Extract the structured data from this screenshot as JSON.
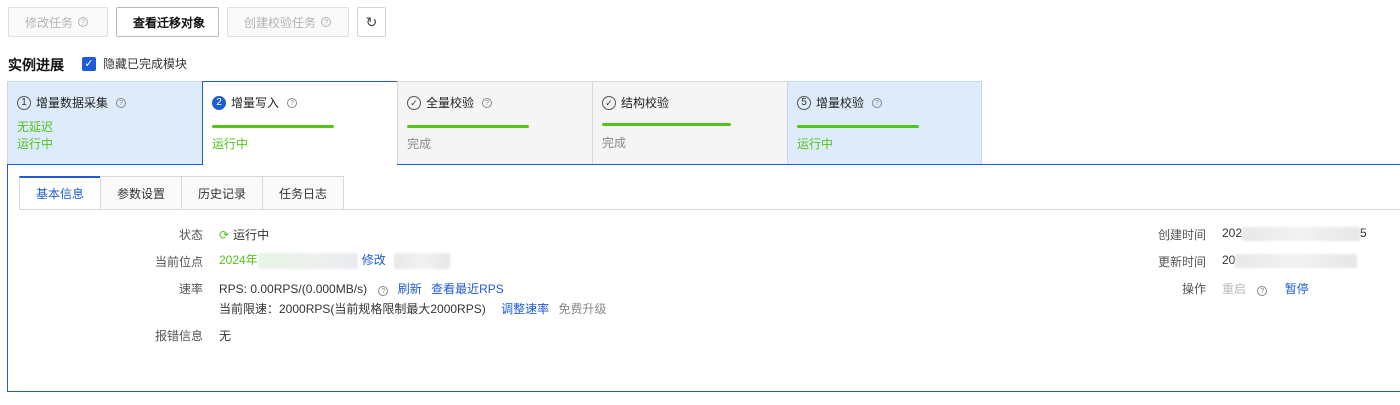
{
  "toolbar": {
    "modify_task": "修改任务",
    "view_migration": "查看迁移对象",
    "create_check_task": "创建校验任务",
    "refresh_icon": "refresh-icon"
  },
  "progress": {
    "title": "实例进展",
    "hide_completed": "隐藏已完成模块",
    "hide_completed_checked": true
  },
  "steps": [
    {
      "num": "1",
      "label": "增量数据采集",
      "line1": "无延迟",
      "line2": "运行中"
    },
    {
      "num": "2",
      "label": "增量写入",
      "status": "运行中"
    },
    {
      "label": "全量校验",
      "status": "完成"
    },
    {
      "label": "结构校验",
      "status": "完成"
    },
    {
      "num": "5",
      "label": "增量校验",
      "status": "运行中"
    }
  ],
  "tabs": [
    "基本信息",
    "参数设置",
    "历史记录",
    "任务日志"
  ],
  "info": {
    "status_label": "状态",
    "status_value": "运行中",
    "position_label": "当前位点",
    "position_value": "2024年",
    "position_modify": "修改",
    "rate_label": "速率",
    "rate_value": "RPS: 0.00RPS/(0.000MB/s)",
    "rate_refresh": "刷新",
    "rate_recent": "查看最近RPS",
    "limit_value": "当前限速：2000RPS(当前规格限制最大2000RPS)",
    "limit_adjust": "调整速率",
    "limit_upgrade": "免费升级",
    "error_label": "报错信息",
    "error_value": "无",
    "created_label": "创建时间",
    "created_value_prefix": "202",
    "created_value_suffix": "5",
    "updated_label": "更新时间",
    "updated_value_prefix": "20",
    "action_label": "操作",
    "action_restart": "重启",
    "action_pause": "暂停"
  }
}
